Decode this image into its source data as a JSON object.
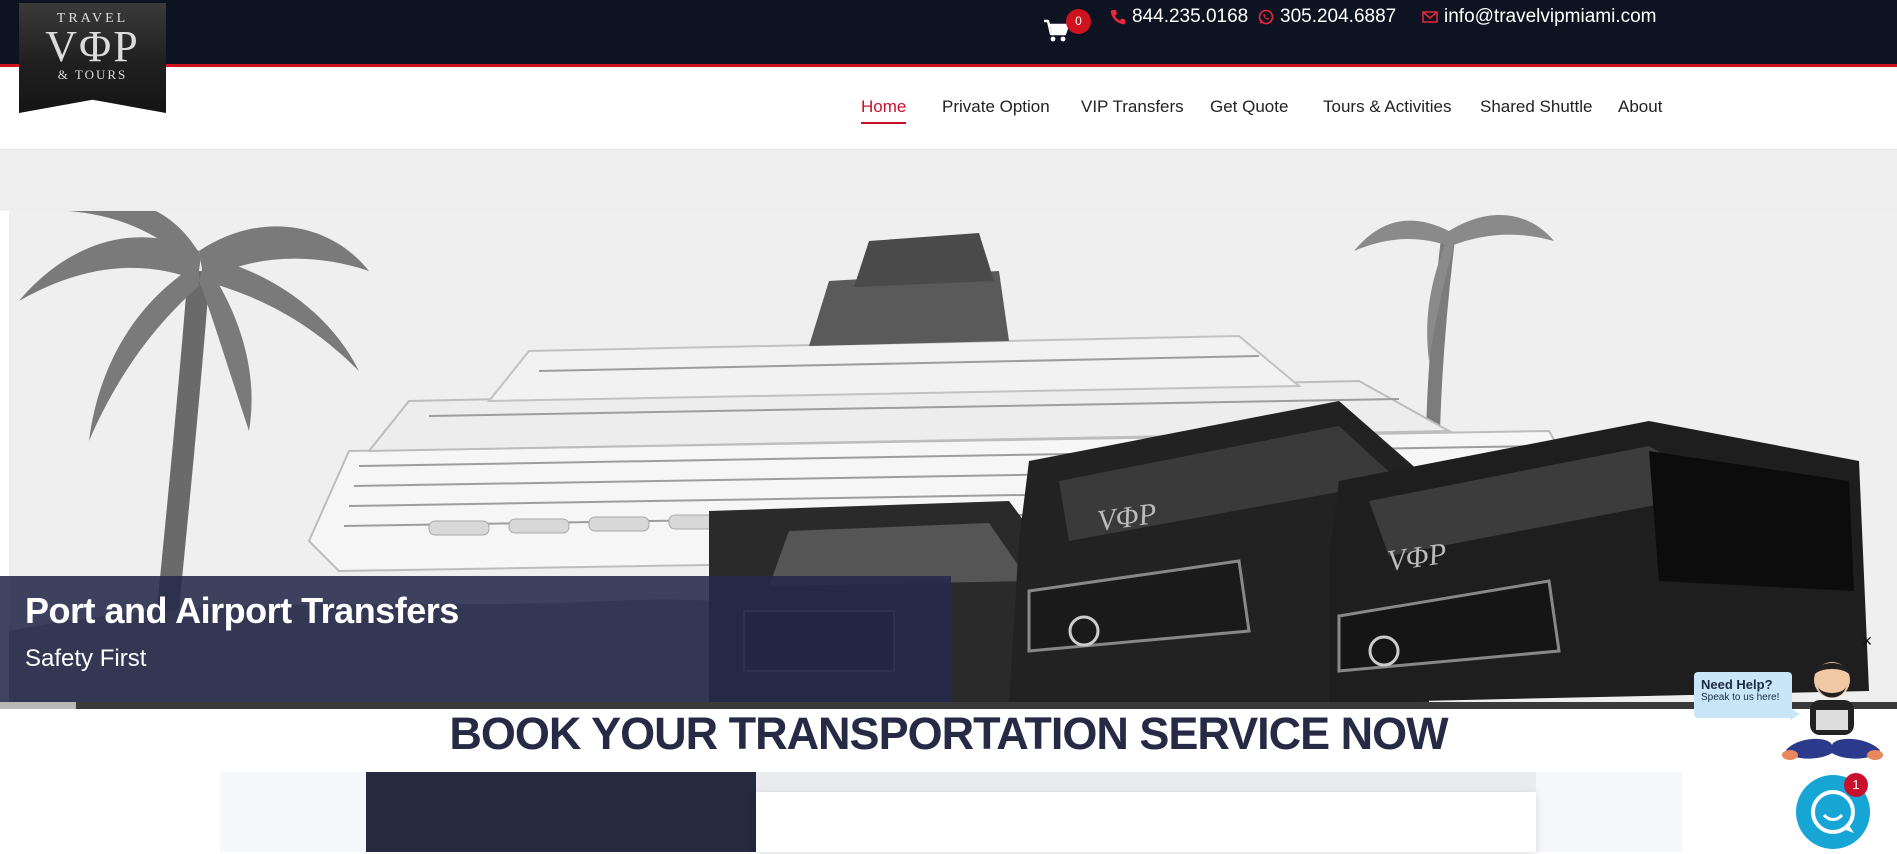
{
  "logo": {
    "line1": "TRAVEL",
    "line2": "VΦP",
    "line3": "& TOURS"
  },
  "topbar": {
    "cart_count": "0",
    "phone1": "844.235.0168",
    "phone2": "305.204.6887",
    "email": "info@travelvipmiami.com"
  },
  "nav": {
    "items": [
      {
        "label": "Home",
        "active": true
      },
      {
        "label": "Private Option"
      },
      {
        "label": "VIP Transfers"
      },
      {
        "label": "Get Quote"
      },
      {
        "label": "Tours & Activities"
      },
      {
        "label": "Shared Shuttle"
      },
      {
        "label": "About"
      }
    ]
  },
  "hero": {
    "title": "Port and Airport Transfers",
    "subtitle": "Safety First",
    "progress_fraction": 0.04
  },
  "booking": {
    "heading": "BOOK YOUR TRANSPORTATION SERVICE NOW"
  },
  "help_widget": {
    "title": "Need Help?",
    "subtitle": "Speak to us here!",
    "chat_badge": "1",
    "close_label": "×"
  },
  "colors": {
    "topbar_bg": "#0e1322",
    "accent_red": "#c8102e",
    "caption_bg": "#25294a",
    "heading": "#262a45",
    "chat_blue": "#17a5d6"
  },
  "icons": [
    "cart-icon",
    "phone-icon",
    "whatsapp-icon",
    "mail-icon",
    "chat-icon",
    "close-icon"
  ]
}
